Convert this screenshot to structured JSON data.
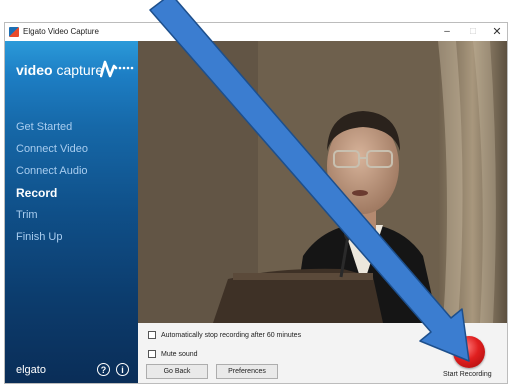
{
  "window": {
    "title": "Elgato Video Capture",
    "minimize": "–",
    "maximize": "□",
    "close": "✕"
  },
  "sidebar": {
    "logo_bold": "video",
    "logo_rest": " capture",
    "items": [
      {
        "label": "Get Started",
        "active": false
      },
      {
        "label": "Connect Video",
        "active": false
      },
      {
        "label": "Connect Audio",
        "active": false
      },
      {
        "label": "Record",
        "active": true
      },
      {
        "label": "Trim",
        "active": false
      },
      {
        "label": "Finish Up",
        "active": false
      }
    ],
    "brand": "elgato",
    "help_glyph": "?",
    "info_glyph": "i"
  },
  "options": {
    "auto_stop": {
      "label": "Automatically stop recording after 60 minutes",
      "checked": false
    },
    "mute": {
      "label": "Mute sound",
      "checked": false
    }
  },
  "buttons": {
    "go_back": "Go Back",
    "preferences": "Preferences",
    "start_recording": "Start Recording"
  },
  "colors": {
    "sidebar_top": "#2b9ad9",
    "sidebar_bottom": "#0a2d57",
    "record": "#e01f1f",
    "arrow": "#3b7dd0",
    "arrow_outline": "#1d4f8c"
  }
}
